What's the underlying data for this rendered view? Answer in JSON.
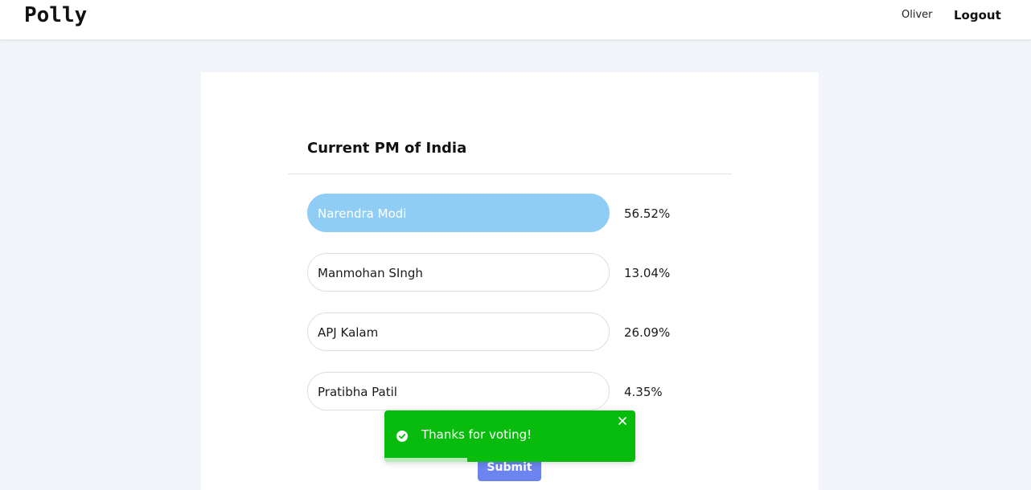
{
  "navbar": {
    "brand": "Polly",
    "user": "Oliver",
    "logout_label": "Logout"
  },
  "poll": {
    "question": "Current PM of India",
    "options": [
      {
        "label": "Narendra Modi",
        "percent": "56.52%",
        "selected": true
      },
      {
        "label": "Manmohan SIngh",
        "percent": "13.04%",
        "selected": false
      },
      {
        "label": "APJ Kalam",
        "percent": "26.09%",
        "selected": false
      },
      {
        "label": "Pratibha Patil",
        "percent": "4.35%",
        "selected": false
      }
    ],
    "submit_label": "Submit"
  },
  "toast": {
    "message": "Thanks for voting!",
    "icon": "check-circle-icon",
    "close_icon": "close-icon",
    "progress": 0.33,
    "color": "#07bc0c"
  },
  "colors": {
    "selected_option": "#90cdf4",
    "submit_button": "#6b84f0",
    "page_background": "#f1f4f9"
  }
}
